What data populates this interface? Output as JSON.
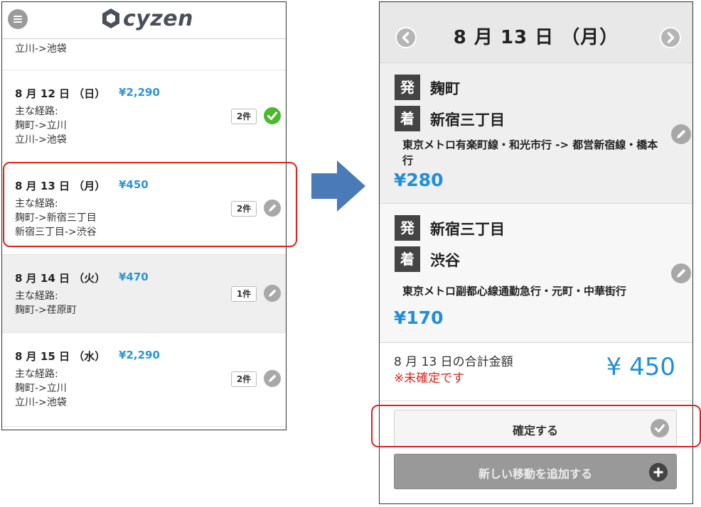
{
  "left": {
    "logo_text": "cyzen",
    "partial_route": "立川->池袋",
    "days": [
      {
        "date": "8 月 12 日 （日）",
        "amount": "¥2,290",
        "routes_label": "主な経路:",
        "routes": [
          "麹町->立川",
          "立川->池袋"
        ],
        "count": "2件",
        "status": "check-icon"
      },
      {
        "date": "8 月 13 日 （月）",
        "amount": "¥450",
        "routes_label": "主な経路:",
        "routes": [
          "麹町->新宿三丁目",
          "新宿三丁目->渋谷"
        ],
        "count": "2件",
        "status": "edit-icon"
      },
      {
        "date": "8 月 14 日 （火）",
        "amount": "¥470",
        "routes_label": "主な経路:",
        "routes": [
          "麹町->荏原町"
        ],
        "count": "1件",
        "status": "edit-icon"
      },
      {
        "date": "8 月 15 日 （水）",
        "amount": "¥2,290",
        "routes_label": "主な経路:",
        "routes": [
          "麹町->立川",
          "立川->池袋"
        ],
        "count": "2件",
        "status": "edit-icon"
      }
    ]
  },
  "right": {
    "title": "8 月 13 日 （月）",
    "trips": [
      {
        "from_tag": "発",
        "from": "麹町",
        "to_tag": "着",
        "to": "新宿三丁目",
        "line": "東京メトロ有楽町線・和光市行 -> 都営新宿線・橋本行",
        "fare": "¥280"
      },
      {
        "from_tag": "発",
        "from": "新宿三丁目",
        "to_tag": "着",
        "to": "渋谷",
        "line": "東京メトロ副都心線通勤急行・元町・中華街行",
        "fare": "¥170"
      }
    ],
    "total_label": "8 月 13 日の合計金額",
    "unconfirmed": "※未確定です",
    "total_amount": "¥ 450",
    "confirm_label": "確定する",
    "add_label": "新しい移動を追加する"
  },
  "colors": {
    "accent": "#1f8fd8",
    "highlight": "#e0211b",
    "arrow": "#4a7ab8",
    "check": "#4cb82e"
  }
}
